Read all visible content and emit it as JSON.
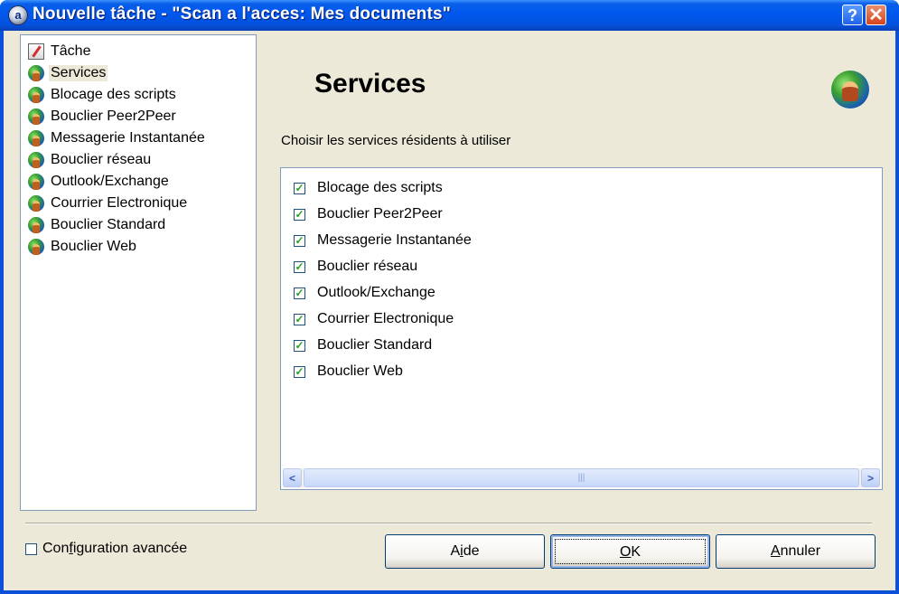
{
  "window": {
    "title": "Nouvelle tâche - \"Scan a l'acces: Mes documents\"",
    "help_label": "?",
    "close_label": "✕"
  },
  "tree": {
    "items": [
      {
        "label": "Tâche",
        "icon": "task-icon",
        "selected": false
      },
      {
        "label": "Services",
        "icon": "globe-icon",
        "selected": true
      },
      {
        "label": "Blocage des scripts",
        "icon": "globe-icon",
        "selected": false
      },
      {
        "label": "Bouclier Peer2Peer",
        "icon": "globe-icon",
        "selected": false
      },
      {
        "label": "Messagerie Instantanée",
        "icon": "globe-icon",
        "selected": false
      },
      {
        "label": "Bouclier réseau",
        "icon": "globe-icon",
        "selected": false
      },
      {
        "label": "Outlook/Exchange",
        "icon": "globe-icon",
        "selected": false
      },
      {
        "label": "Courrier Electronique",
        "icon": "globe-icon",
        "selected": false
      },
      {
        "label": "Bouclier Standard",
        "icon": "globe-icon",
        "selected": false
      },
      {
        "label": "Bouclier Web",
        "icon": "globe-icon",
        "selected": false
      }
    ]
  },
  "main": {
    "heading": "Services",
    "subtitle": "Choisir les services résidents à utiliser",
    "services": [
      {
        "label": "Blocage des scripts",
        "checked": true
      },
      {
        "label": "Bouclier Peer2Peer",
        "checked": true
      },
      {
        "label": "Messagerie Instantanée",
        "checked": true
      },
      {
        "label": "Bouclier réseau",
        "checked": true
      },
      {
        "label": "Outlook/Exchange",
        "checked": true
      },
      {
        "label": "Courrier Electronique",
        "checked": true
      },
      {
        "label": "Bouclier Standard",
        "checked": true
      },
      {
        "label": "Bouclier Web",
        "checked": true
      }
    ],
    "scroll_left": "<",
    "scroll_right": ">",
    "scroll_grip": "|||"
  },
  "footer": {
    "advanced_pre": "Con",
    "advanced_key": "f",
    "advanced_post": "iguration avancée",
    "advanced_checked": false,
    "aide_pre": "A",
    "aide_key": "i",
    "aide_post": "de",
    "ok_key": "O",
    "ok_post": "K",
    "annuler_key": "A",
    "annuler_post": "nnuler"
  },
  "colors": {
    "title_bar": "#0058ee",
    "dialog_bg": "#ece9d8",
    "check_mark": "#21a121",
    "close_button": "#d5431b"
  }
}
